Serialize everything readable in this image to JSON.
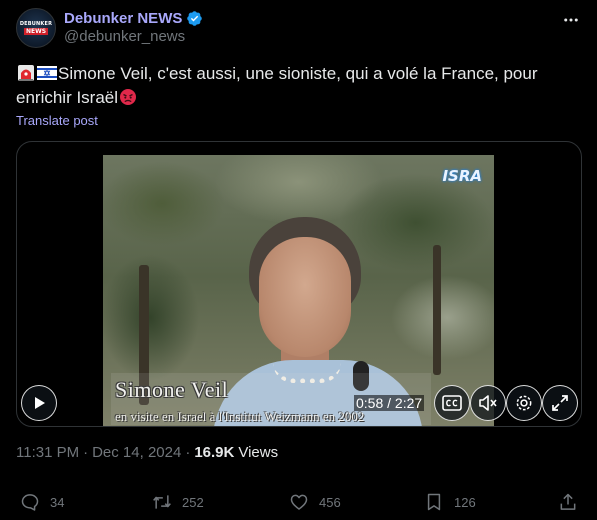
{
  "author": {
    "name": "Debunker NEWS",
    "handle": "@debunker_news",
    "avatar_text_top": "DEBUNKER",
    "avatar_text_bottom": "NEWS",
    "verified_color": "#1d9bf0"
  },
  "post": {
    "text": "Simone Veil, c'est aussi, une sioniste, qui a volé la France, pour enrichir Israël",
    "leading_emojis": [
      "rotating-light-emoji",
      "israel-flag-emoji"
    ],
    "trailing_emoji": "angry-face-emoji",
    "translate_label": "Translate post"
  },
  "video": {
    "channel_logo": "ISRA",
    "caption_name": "Simone Veil",
    "caption_sub": "en visite en Israel à l'Institut Weizmann en 2002",
    "time": "0:58 / 2:27",
    "progress": 0.395
  },
  "meta": {
    "time": "11:31 PM",
    "separator": "·",
    "date": "Dec 14, 2024",
    "views_count": "16.9K",
    "views_label": "Views"
  },
  "actions": {
    "replies": "34",
    "reposts": "252",
    "likes": "456",
    "bookmarks": "126"
  },
  "colors": {
    "background": "#000000",
    "accent": "#a9a8fb",
    "muted": "#71767b",
    "text": "#e7e9ea",
    "border": "#2f3336"
  }
}
